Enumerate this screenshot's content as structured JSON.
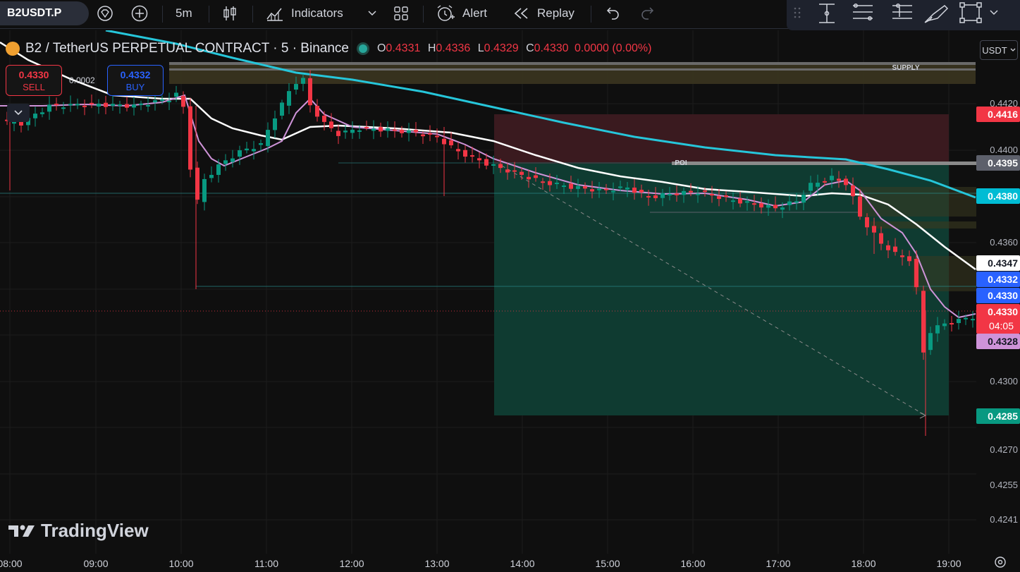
{
  "toolbar": {
    "symbol": "B2USDT.P",
    "interval": "5m",
    "indicators_label": "Indicators",
    "alert_label": "Alert",
    "replay_label": "Replay"
  },
  "legend": {
    "title": "B2 / TetherUS PERPETUAL CONTRACT · 5 · Binance",
    "o_key": "O",
    "o_val": "0.4331",
    "h_key": "H",
    "h_val": "0.4336",
    "l_key": "L",
    "l_val": "0.4329",
    "c_key": "C",
    "c_val": "0.4330",
    "change": "0.0000 (0.00%)"
  },
  "trade": {
    "sell_price": "0.4330",
    "sell_label": "SELL",
    "spread": "0.0002",
    "buy_price": "0.4332",
    "buy_label": "BUY"
  },
  "currency": "USDT",
  "zone_labels": {
    "supply": "SUPPLY",
    "poi": "POI"
  },
  "logo_text": "TradingView",
  "price_axis": {
    "ticks": [
      "0.4420",
      "0.4400",
      "0.4360",
      "0.4300",
      "0.4270",
      "0.4255",
      "0.4241"
    ],
    "badges": [
      {
        "text": "0.4416",
        "color": "#f23645",
        "fg": "#ffffff"
      },
      {
        "text": "0.4395",
        "color": "#5d606b",
        "fg": "#ffffff"
      },
      {
        "text": "0.4380",
        "color": "#00bcd4",
        "fg": "#ffffff"
      },
      {
        "text": "0.4347",
        "color": "#ffffff",
        "fg": "#131722"
      },
      {
        "text": "0.4332",
        "color": "#2962ff",
        "fg": "#ffffff"
      },
      {
        "text": "0.4330",
        "color": "#2962ff",
        "fg": "#ffffff"
      },
      {
        "text": "0.4330",
        "color": "#f23645",
        "fg": "#ffffff",
        "sub": "04:05"
      },
      {
        "text": "0.4328",
        "color": "#ce93d8",
        "fg": "#131722"
      },
      {
        "text": "0.4285",
        "color": "#089981",
        "fg": "#ffffff"
      }
    ]
  },
  "time_axis": [
    "08:00",
    "09:00",
    "10:00",
    "11:00",
    "12:00",
    "13:00",
    "14:00",
    "15:00",
    "16:00",
    "17:00",
    "18:00",
    "19:00"
  ],
  "colors": {
    "up": "#089981",
    "down": "#f23645",
    "ema_fast": "#ce93d8",
    "ema_mid": "#ffffff",
    "ema_slow": "#26c6da"
  }
}
